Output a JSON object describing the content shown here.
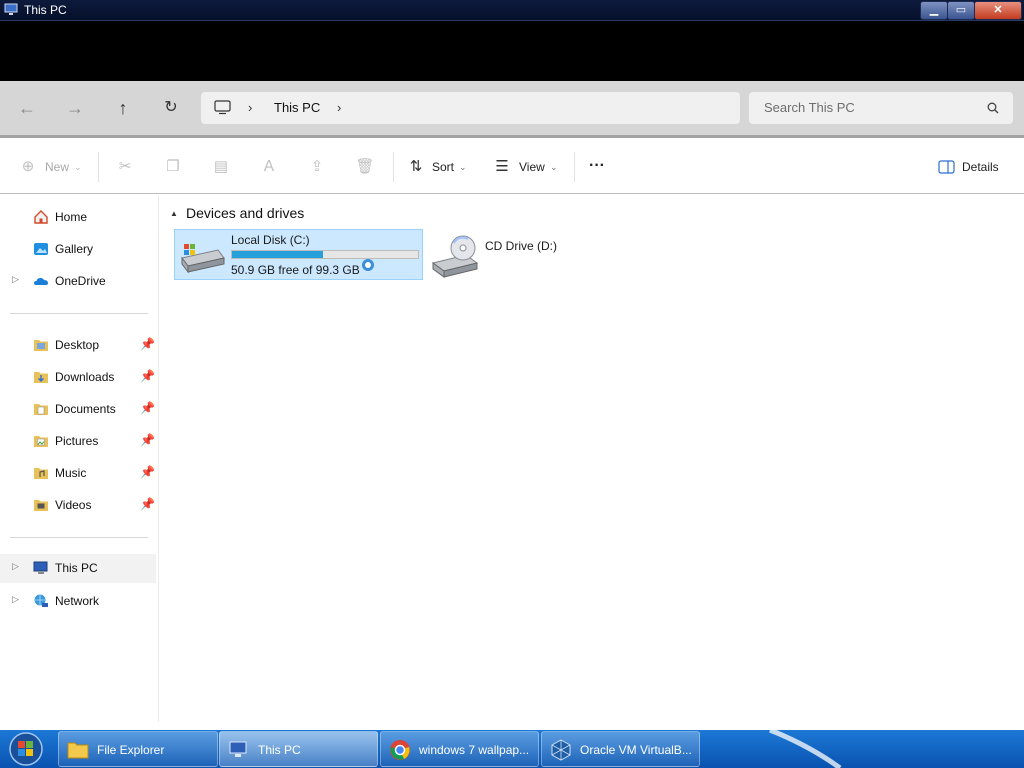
{
  "window": {
    "title": "This PC",
    "minimize": "▁",
    "maximize": "▭",
    "close": "✕"
  },
  "nav": {
    "address_label": "This PC",
    "search_placeholder": "Search This PC"
  },
  "commandbar": {
    "new_label": "New",
    "sort_label": "Sort",
    "view_label": "View",
    "more_label": "···",
    "details_label": "Details"
  },
  "sidebar": {
    "top": [
      {
        "label": "Home"
      },
      {
        "label": "Gallery"
      },
      {
        "label": "OneDrive"
      }
    ],
    "quick": [
      {
        "label": "Desktop"
      },
      {
        "label": "Downloads"
      },
      {
        "label": "Documents"
      },
      {
        "label": "Pictures"
      },
      {
        "label": "Music"
      },
      {
        "label": "Videos"
      }
    ],
    "bottom": [
      {
        "label": "This PC"
      },
      {
        "label": "Network"
      }
    ]
  },
  "content": {
    "group_title": "Devices and drives",
    "drives": [
      {
        "name": "Local Disk (C:)",
        "free_text": "50.9 GB free of 99.3 GB",
        "used_fraction": 0.487
      },
      {
        "name": "CD Drive (D:)"
      }
    ]
  },
  "taskbar": {
    "items": [
      {
        "label": "File Explorer"
      },
      {
        "label": "This PC"
      },
      {
        "label": "windows 7 wallpap..."
      },
      {
        "label": "Oracle VM VirtualB..."
      }
    ]
  },
  "colors": {
    "accent": "#26a0da",
    "selection": "#cce8ff",
    "taskbar": "#1c78d6"
  }
}
